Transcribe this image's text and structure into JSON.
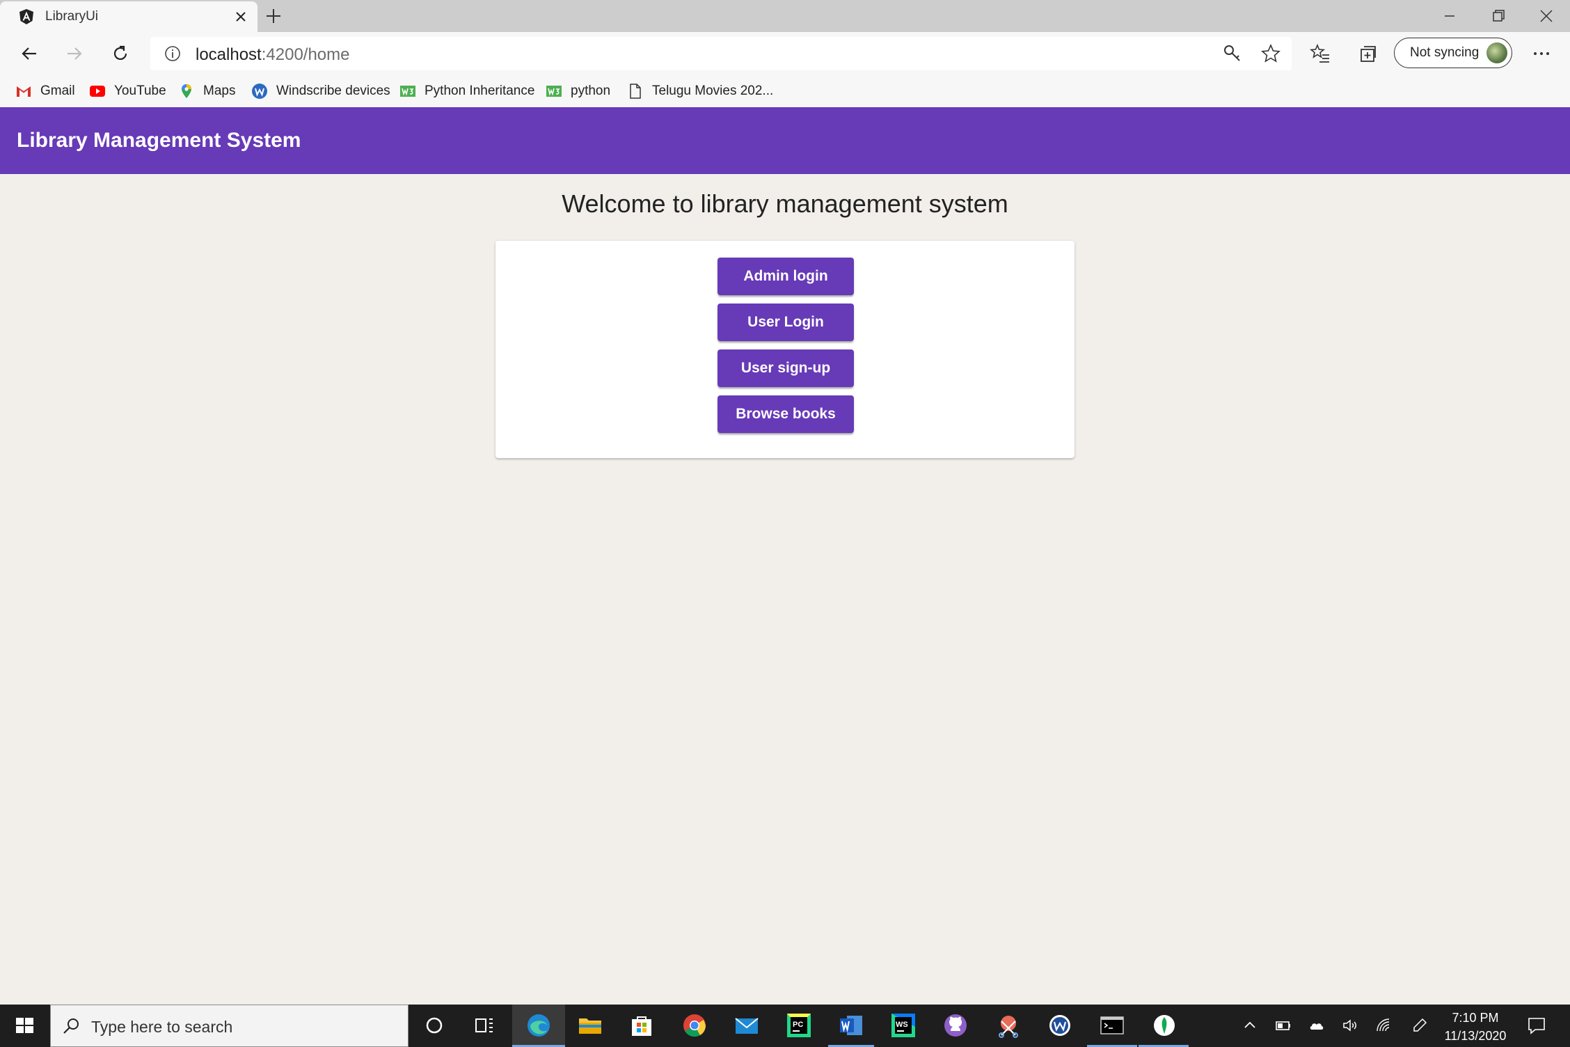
{
  "browser": {
    "tab_title": "LibraryUi",
    "url_host": "localhost",
    "url_path": ":4200/home",
    "sync_label": "Not syncing"
  },
  "bookmarks": [
    {
      "label": "Gmail",
      "icon": "gmail-icon"
    },
    {
      "label": "YouTube",
      "icon": "youtube-icon"
    },
    {
      "label": "Maps",
      "icon": "maps-icon"
    },
    {
      "label": "Windscribe devices",
      "icon": "windscribe-icon"
    },
    {
      "label": "Python Inheritance",
      "icon": "w3schools-icon"
    },
    {
      "label": "python",
      "icon": "w3schools-icon"
    },
    {
      "label": "Telugu Movies 202...",
      "icon": "document-icon"
    }
  ],
  "app": {
    "title": "Library Management System",
    "welcome": "Welcome to library management system",
    "buttons": {
      "admin_login": "Admin login",
      "user_login": "User Login",
      "user_signup": "User sign-up",
      "browse_books": "Browse books"
    },
    "colors": {
      "primary": "#673ab7",
      "background": "#f2efeb"
    }
  },
  "taskbar": {
    "search_placeholder": "Type here to search",
    "time": "7:10 PM",
    "date": "11/13/2020"
  }
}
